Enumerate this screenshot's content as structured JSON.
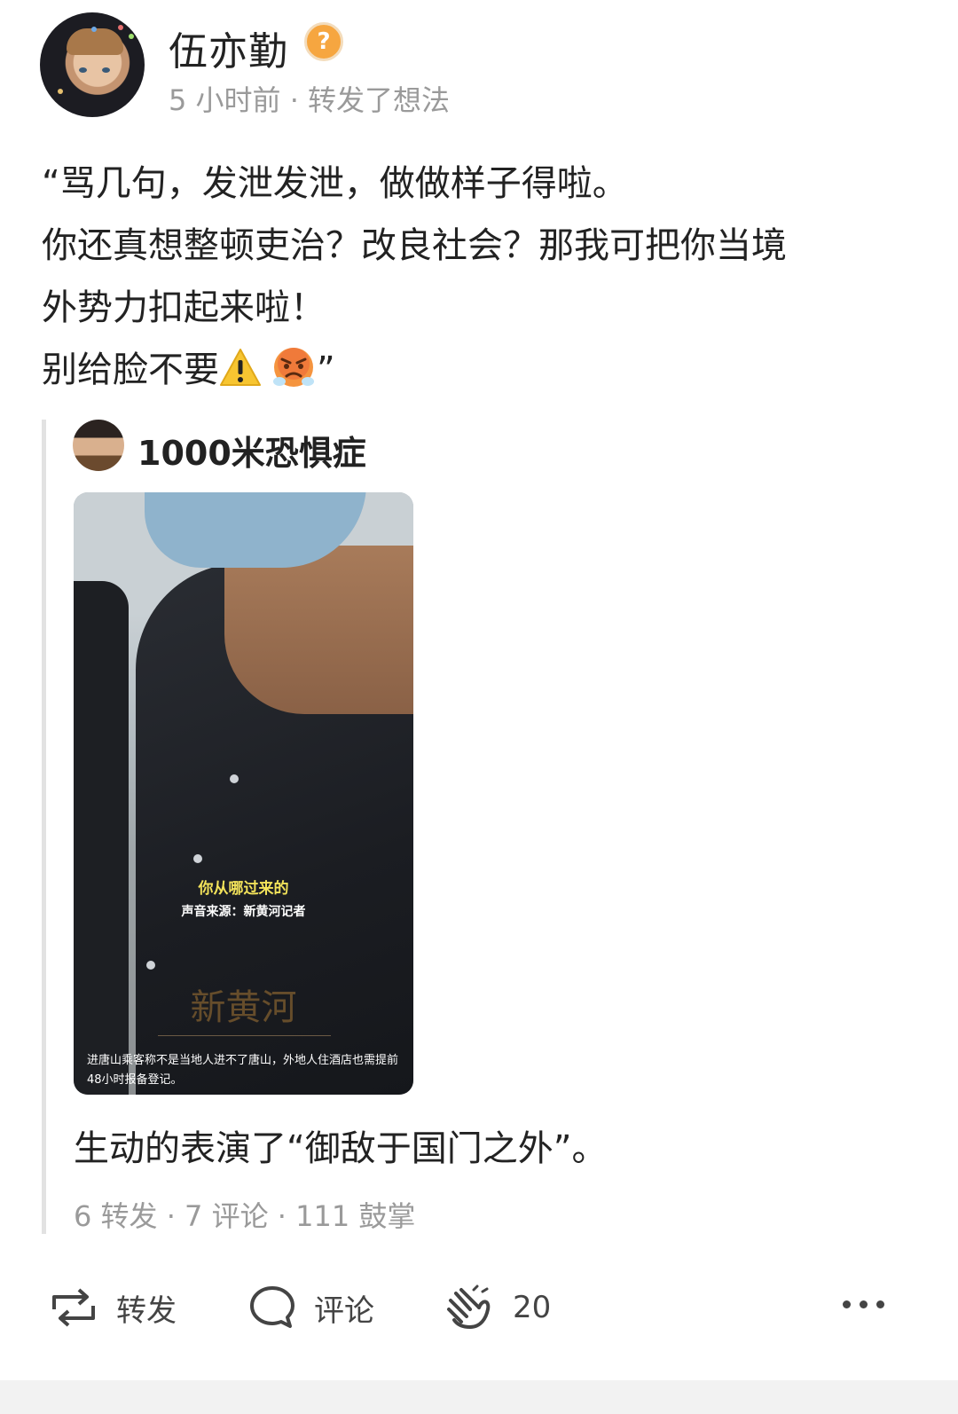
{
  "author": {
    "name": "伍亦勤",
    "badge_symbol": "?",
    "meta": "5 小时前 · 转发了想法"
  },
  "post": {
    "lines": [
      "“骂几句，发泄发泄，做做样子得啦。",
      "你还真想整顿吏治？改良社会？那我可把你当境",
      "外势力扣起来啦！",
      "别给脸不要"
    ],
    "closing_quote": "”",
    "emoji": [
      "warning-sign",
      "angry-face"
    ]
  },
  "quoted": {
    "name": "1000米恐惧症",
    "video": {
      "subtitle_1": "你从哪过来的",
      "subtitle_2": "声音来源：新黄河记者",
      "logo": "新黄河",
      "caption": "进唐山乘客称不是当地人进不了唐山，外地人住酒店也需提前48小时报备登记。"
    },
    "text": "生动的表演了“御敌于国门之外”。",
    "stats": "6 转发 · 7 评论 · 111 鼓掌"
  },
  "actions": {
    "repost_label": "转发",
    "comment_label": "评论",
    "applause_count": "20"
  },
  "colors": {
    "text": "#222222",
    "meta": "#9a9a9a",
    "badge": "#f6a640",
    "quote_bar": "#e2e2e2"
  }
}
